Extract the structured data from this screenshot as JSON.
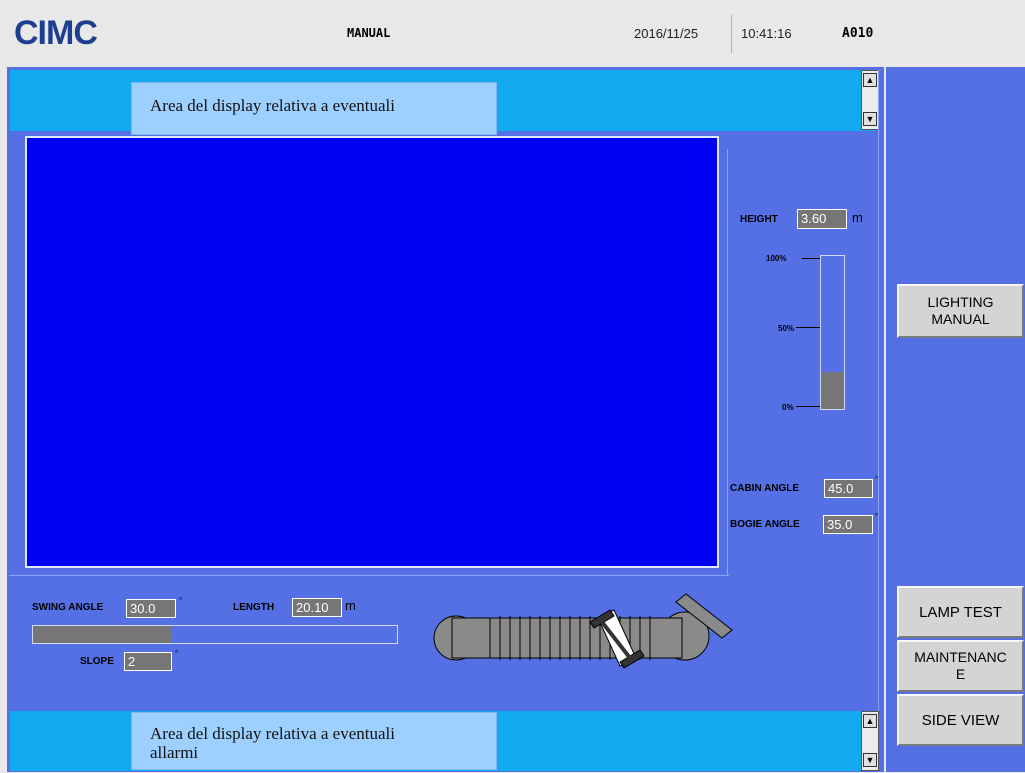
{
  "header": {
    "logo": "CIMC",
    "mode": "MANUAL",
    "date": "2016/11/25",
    "time": "10:41:16",
    "code": "A010"
  },
  "alarm_top": {
    "text": "Area del display relativa a eventuali"
  },
  "alarm_bottom": {
    "text_line1": "Area del display relativa a eventuali",
    "text_line2": "allarmi"
  },
  "height": {
    "label": "HEIGHT",
    "value": "3.60",
    "unit": "m",
    "scale": [
      "100%",
      "50%",
      "0%"
    ],
    "level_percent": 24
  },
  "cabin_angle": {
    "label": "CABIN ANGLE",
    "value": "45.0",
    "unit": "°"
  },
  "bogie_angle": {
    "label": "BOGIE ANGLE",
    "value": "35.0",
    "unit": "°"
  },
  "swing_angle": {
    "label": "SWING ANGLE",
    "value": "30.0",
    "unit": "°"
  },
  "length": {
    "label": "LENGTH",
    "value": "20.10",
    "unit": "m",
    "level_percent": 38
  },
  "slope": {
    "label": "SLOPE",
    "value": "2",
    "unit": "°"
  },
  "buttons": {
    "lighting_line1": "LIGHTING",
    "lighting_line2": "MANUAL",
    "lamp_test": "LAMP TEST",
    "maintenance_line1": "MAINTENANC",
    "maintenance_line2": "E",
    "side_view": "SIDE VIEW"
  },
  "colors": {
    "panel": "#5470e4",
    "alarm_bar": "#12aaee",
    "display": "#0000f5",
    "value_box": "#767676"
  }
}
